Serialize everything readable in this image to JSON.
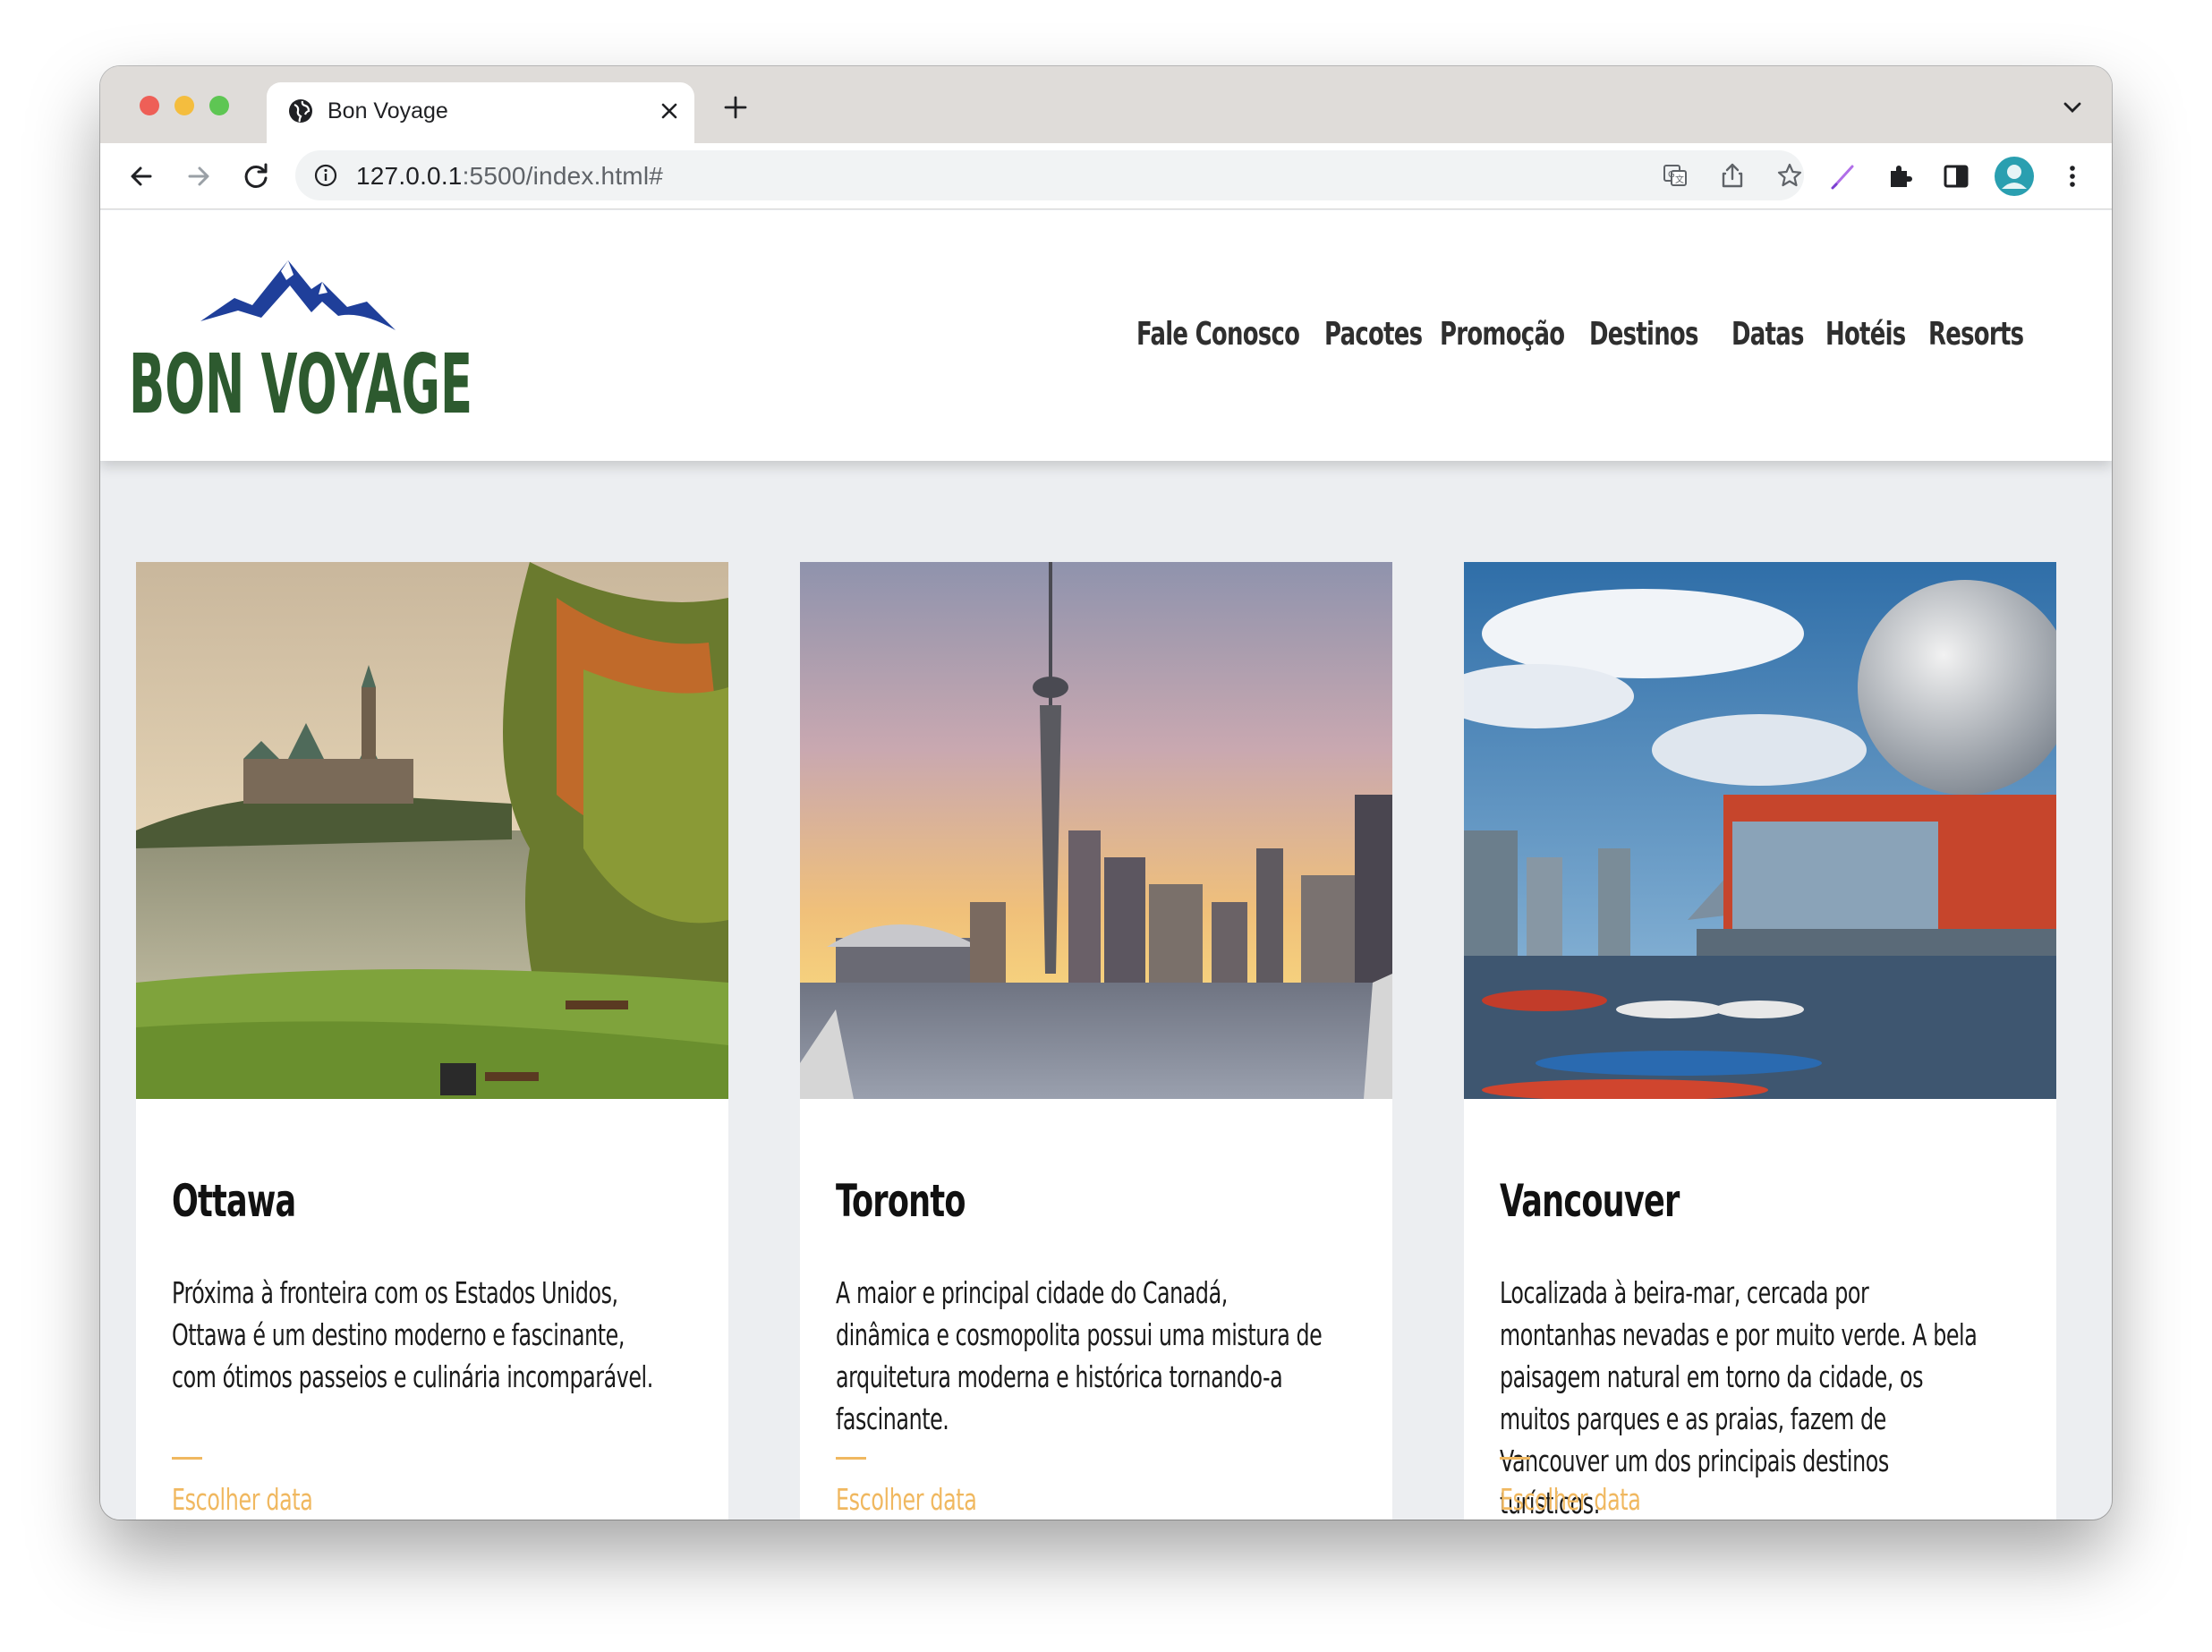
{
  "browser": {
    "tab_title": "Bon Voyage",
    "url_host": "127.0.0.1",
    "url_rest": ":5500/index.html#"
  },
  "site": {
    "logo_text": "BON VOYAGE",
    "brand_color": "#2d5a2f",
    "mountain_color": "#1f3f9a",
    "accent_color": "#f0b860",
    "nav": [
      "Fale Conosco",
      "Pacotes",
      "Promoção",
      "Destinos",
      "Datas",
      "Hotéis",
      "Resorts"
    ]
  },
  "cards": [
    {
      "title": "Ottawa",
      "description": "Próxima à fronteira com os Estados Unidos, Ottawa é um destino moderno e fascinante, com ótimos passeios e culinária incomparável.",
      "link": "Escolher data",
      "image": "ottawa-parliament-autumn-photo"
    },
    {
      "title": "Toronto",
      "description": "A maior e principal cidade do Canadá, dinâmica e cosmopolita possui uma mistura de arquitetura moderna e histórica tornando-a fascinante.",
      "link": "Escolher data",
      "image": "toronto-cn-tower-skyline-photo"
    },
    {
      "title": "Vancouver",
      "description": "Localizada à beira-mar, cercada por montanhas nevadas e por muito verde. A bela paisagem natural em torno da cidade, os muitos parques e as praias, fazem de Vancouver um dos principais destinos turísticos.",
      "link": "Escolher data",
      "image": "vancouver-science-world-photo"
    }
  ]
}
